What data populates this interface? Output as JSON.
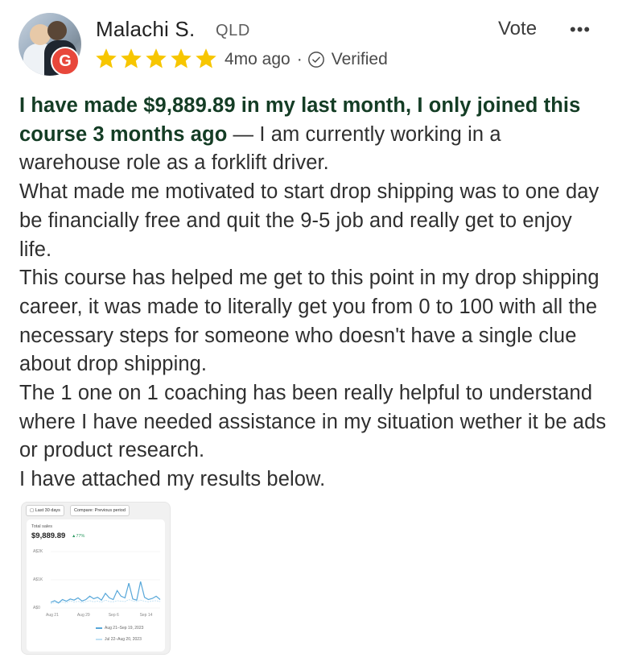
{
  "reviewer": {
    "name": "Malachi S.",
    "region": "QLD",
    "avatar_badge_letter": "G",
    "avatar_badge_color": "#e8473b"
  },
  "actions": {
    "vote_label": "Vote",
    "more_label": "•••"
  },
  "rating": {
    "stars": 5,
    "max": 5,
    "star_color": "#f7c600"
  },
  "meta": {
    "time_ago": "4mo ago",
    "separator": "·",
    "verified_label": "Verified",
    "verified_icon": "check-circle-icon"
  },
  "review": {
    "lead": "I have made $9,889.89 in my last month, I only joined this course 3 months ago",
    "lead_color": "#143d25",
    "first_line_rest": " — I am currently working in a warehouse role as a forklift driver.",
    "paragraphs": [
      "What made me motivated to start drop shipping was to one day be financially free and quit the 9-5 job and really get to enjoy life.",
      "This course has helped me get to this point in my drop shipping career, it was made to literally get you from 0 to 100 with all the necessary steps for someone who doesn't have a single clue about drop shipping.",
      "The 1 one on 1 coaching has been really helpful to understand where I have needed assistance in my situation wether it be ads or product research.",
      "I have attached my results below."
    ]
  },
  "attachment": {
    "chip_date": "Last 30 days",
    "chip_compare": "Compare: Previous period",
    "metric_label": "Total sales",
    "metric_value": "$9,889.89",
    "metric_change": "▲77%",
    "chart_data": {
      "type": "line",
      "title": "",
      "xlabel": "",
      "ylabel": "",
      "y_tick_labels": [
        "A$2K",
        "A$1K",
        "A$0"
      ],
      "y_tick_values": [
        2000,
        1000,
        0
      ],
      "ylim": [
        0,
        2000
      ],
      "x_tick_labels": [
        "Aug 21",
        "Aug 29",
        "Sep 6",
        "Sep 14"
      ],
      "x_tick_index": [
        0,
        8,
        16,
        24
      ],
      "grid": true,
      "legend_placement": "bottom-right",
      "series": [
        {
          "name": "Aug 21–Sep 19, 2023",
          "color": "#57a7d9",
          "values": [
            200,
            260,
            180,
            300,
            240,
            320,
            280,
            360,
            250,
            300,
            420,
            330,
            380,
            280,
            520,
            360,
            300,
            620,
            420,
            360,
            880,
            320,
            280,
            940,
            380,
            300,
            340,
            420,
            300
          ]
        },
        {
          "name": "Jul 22–Aug 20, 2023",
          "color": "#bfe0f3",
          "values": [
            150,
            200,
            170,
            220,
            180,
            260,
            210,
            240,
            190,
            230,
            260,
            220,
            250,
            210,
            280,
            230,
            220,
            260,
            240,
            230,
            300,
            250,
            230,
            280,
            240,
            220,
            250,
            260,
            230
          ]
        }
      ]
    }
  }
}
